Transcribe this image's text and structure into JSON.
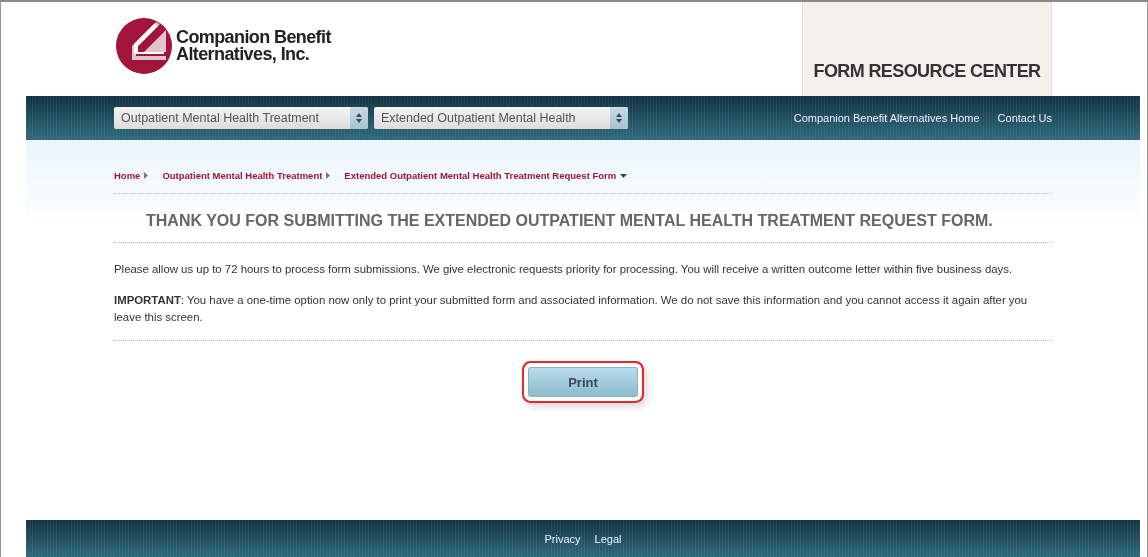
{
  "logo": {
    "line1": "Companion Benefit",
    "line2": "Alternatives, Inc."
  },
  "header_tab": {
    "title": "FORM RESOURCE CENTER"
  },
  "nav": {
    "selects": [
      {
        "value": "Outpatient Mental Health Treatment"
      },
      {
        "value": "Extended Outpatient Mental Health"
      }
    ],
    "links": [
      "Companion Benefit Alternatives Home",
      "Contact Us"
    ]
  },
  "breadcrumb": [
    {
      "label": "Home",
      "current": false
    },
    {
      "label": "Outpatient Mental Health Treatment",
      "current": false
    },
    {
      "label": "Extended Outpatient Mental Health Treatment Request Form",
      "current": true
    }
  ],
  "heading": "THANK YOU FOR SUBMITTING THE EXTENDED OUTPATIENT MENTAL HEALTH TREATMENT REQUEST FORM.",
  "paragraphs": [
    "Please allow us up to 72 hours to process form submissions. We give electronic requests priority for processing. You will receive a written outcome letter within five business days.",
    "**IMPORTANT**: You have a one-time option now only to print your submitted form and associated information. We do not save this information and you cannot access it again after you leave this screen."
  ],
  "print_button": {
    "label": "Print",
    "highlighted": true
  },
  "footer": {
    "links": [
      "Privacy",
      "Legal"
    ]
  }
}
